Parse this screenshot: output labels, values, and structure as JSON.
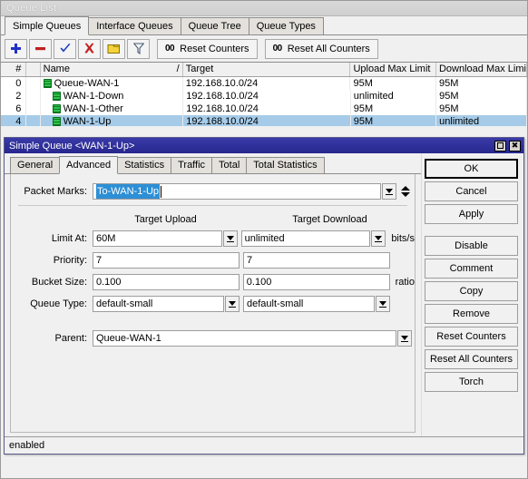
{
  "window": {
    "title": "Queue List"
  },
  "main_tabs": [
    {
      "label": "Simple Queues",
      "active": true
    },
    {
      "label": "Interface Queues",
      "active": false
    },
    {
      "label": "Queue Tree",
      "active": false
    },
    {
      "label": "Queue Types",
      "active": false
    }
  ],
  "toolbar": {
    "icons": [
      {
        "name": "add-icon",
        "glyph": "+"
      },
      {
        "name": "remove-icon",
        "glyph": "–"
      },
      {
        "name": "enable-icon",
        "glyph": "✔"
      },
      {
        "name": "disable-icon",
        "glyph": "✖"
      },
      {
        "name": "comment-icon",
        "glyph": "▰"
      },
      {
        "name": "filter-icon",
        "glyph": "▽"
      }
    ],
    "reset_counters_label": "Reset Counters",
    "reset_all_counters_label": "Reset All Counters",
    "counter_badge": "00"
  },
  "table": {
    "columns": [
      "#",
      "",
      "Name",
      "Target",
      "Upload Max Limit",
      "Download Max Limit"
    ],
    "sort_indicator": "/",
    "rows": [
      {
        "num": "0",
        "name": "Queue-WAN-1",
        "indent": 0,
        "target": "192.168.10.0/24",
        "upload": "95M",
        "download": "95M",
        "selected": false
      },
      {
        "num": "2",
        "name": "WAN-1-Down",
        "indent": 1,
        "target": "192.168.10.0/24",
        "upload": "unlimited",
        "download": "95M",
        "selected": false
      },
      {
        "num": "6",
        "name": "WAN-1-Other",
        "indent": 1,
        "target": "192.168.10.0/24",
        "upload": "95M",
        "download": "95M",
        "selected": false
      },
      {
        "num": "4",
        "name": "WAN-1-Up",
        "indent": 1,
        "target": "192.168.10.0/24",
        "upload": "95M",
        "download": "unlimited",
        "selected": true
      }
    ]
  },
  "dialog": {
    "title": "Simple Queue <WAN-1-Up>",
    "tabs": [
      {
        "label": "General",
        "active": false
      },
      {
        "label": "Advanced",
        "active": true
      },
      {
        "label": "Statistics",
        "active": false
      },
      {
        "label": "Traffic",
        "active": false
      },
      {
        "label": "Total",
        "active": false
      },
      {
        "label": "Total Statistics",
        "active": false
      }
    ],
    "fields": {
      "packet_marks_label": "Packet Marks:",
      "packet_marks_value": "To-WAN-1-Up",
      "col_upload_header": "Target Upload",
      "col_download_header": "Target Download",
      "limit_at_label": "Limit At:",
      "limit_at_upload": "60M",
      "limit_at_download": "unlimited",
      "limit_at_unit": "bits/s",
      "priority_label": "Priority:",
      "priority_upload": "7",
      "priority_download": "7",
      "bucket_size_label": "Bucket Size:",
      "bucket_size_upload": "0.100",
      "bucket_size_download": "0.100",
      "bucket_size_unit": "ratio",
      "queue_type_label": "Queue Type:",
      "queue_type_upload": "default-small",
      "queue_type_download": "default-small",
      "parent_label": "Parent:",
      "parent_value": "Queue-WAN-1"
    },
    "buttons": [
      "OK",
      "Cancel",
      "Apply",
      "Disable",
      "Comment",
      "Copy",
      "Remove",
      "Reset Counters",
      "Reset All Counters",
      "Torch"
    ],
    "status": "enabled",
    "window_buttons": {
      "maximize": "maximize-button",
      "close": "close-button"
    }
  },
  "colors": {
    "dialog_titlebar": "#2c2c9e",
    "selection_row": "#a5cbe8",
    "text_selection": "#2d8fd5",
    "queue_icon_green": "#2fc44a",
    "face": "#f0f0f0"
  }
}
